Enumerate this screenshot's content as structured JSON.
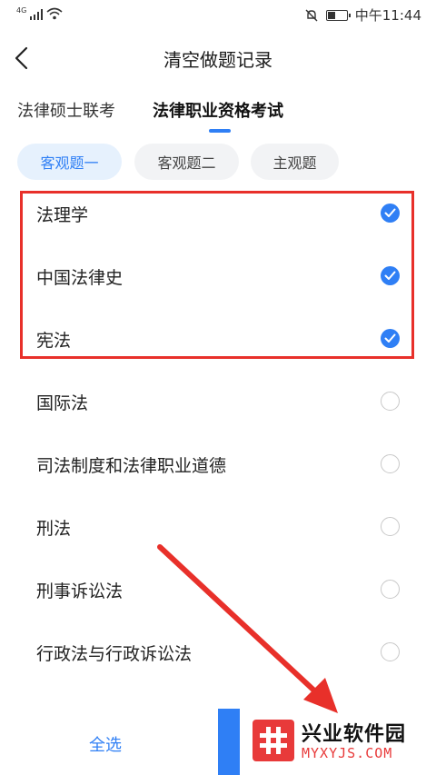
{
  "status_bar": {
    "network": "4G",
    "time": "中午11:44"
  },
  "nav": {
    "title": "清空做题记录"
  },
  "tabs": [
    {
      "label": "法律硕士联考",
      "active": false
    },
    {
      "label": "法律职业资格考试",
      "active": true
    }
  ],
  "sub_tabs": [
    {
      "label": "客观题一",
      "active": true
    },
    {
      "label": "客观题二",
      "active": false
    },
    {
      "label": "主观题",
      "active": false
    }
  ],
  "subjects": [
    {
      "label": "法理学",
      "checked": true
    },
    {
      "label": "中国法律史",
      "checked": true
    },
    {
      "label": "宪法",
      "checked": true
    },
    {
      "label": "国际法",
      "checked": false
    },
    {
      "label": "司法制度和法律职业道德",
      "checked": false
    },
    {
      "label": "刑法",
      "checked": false
    },
    {
      "label": "刑事诉讼法",
      "checked": false
    },
    {
      "label": "行政法与行政诉讼法",
      "checked": false
    }
  ],
  "bottom": {
    "select_all": "全选"
  },
  "watermark": {
    "name": "兴业软件园",
    "url": "MYXYJS.COM"
  },
  "colors": {
    "accent": "#2f7ff5",
    "highlight": "#e8302a"
  }
}
